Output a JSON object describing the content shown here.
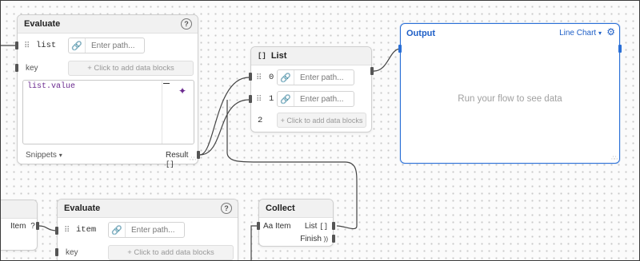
{
  "evaluate_top": {
    "title": "Evaluate",
    "help": "?",
    "list_label": "list",
    "path_placeholder": "Enter path...",
    "key_label": "key",
    "add_blocks": "+ Click to add data blocks",
    "code": "list.value",
    "snippets_label": "Snippets",
    "result_label": "Result",
    "result_icon": "[]"
  },
  "list_node": {
    "icon": "[]",
    "title": "List",
    "rows": [
      {
        "index": "0",
        "placeholder": "Enter path..."
      },
      {
        "index": "1",
        "placeholder": "Enter path..."
      },
      {
        "index": "2",
        "add": "+ Click to add data blocks"
      }
    ]
  },
  "output_node": {
    "title": "Output",
    "chart_type": "Line Chart",
    "empty_message": "Run your flow to see data"
  },
  "left_partial": {
    "item_label": "Item",
    "item_icon": "?"
  },
  "evaluate_bottom": {
    "title": "Evaluate",
    "help": "?",
    "item_label": "item",
    "path_placeholder": "Enter path...",
    "key_label": "key",
    "add_blocks": "+ Click to add data blocks"
  },
  "collect_node": {
    "title": "Collect",
    "item_type": "Aa",
    "item_label": "Item",
    "list_label": "List",
    "list_icon": "[]",
    "finish_label": "Finish",
    "finish_icon": "))"
  },
  "icons": {
    "help": "help-circle-icon",
    "link": "link-icon",
    "drag": "drag-handle-icon",
    "settings": "gear-icon",
    "chevron": "chevron-down-icon",
    "ai": "sparkle-icon"
  },
  "colors": {
    "output_accent": "#2a6fd6",
    "code_text": "#6b2a8f"
  }
}
